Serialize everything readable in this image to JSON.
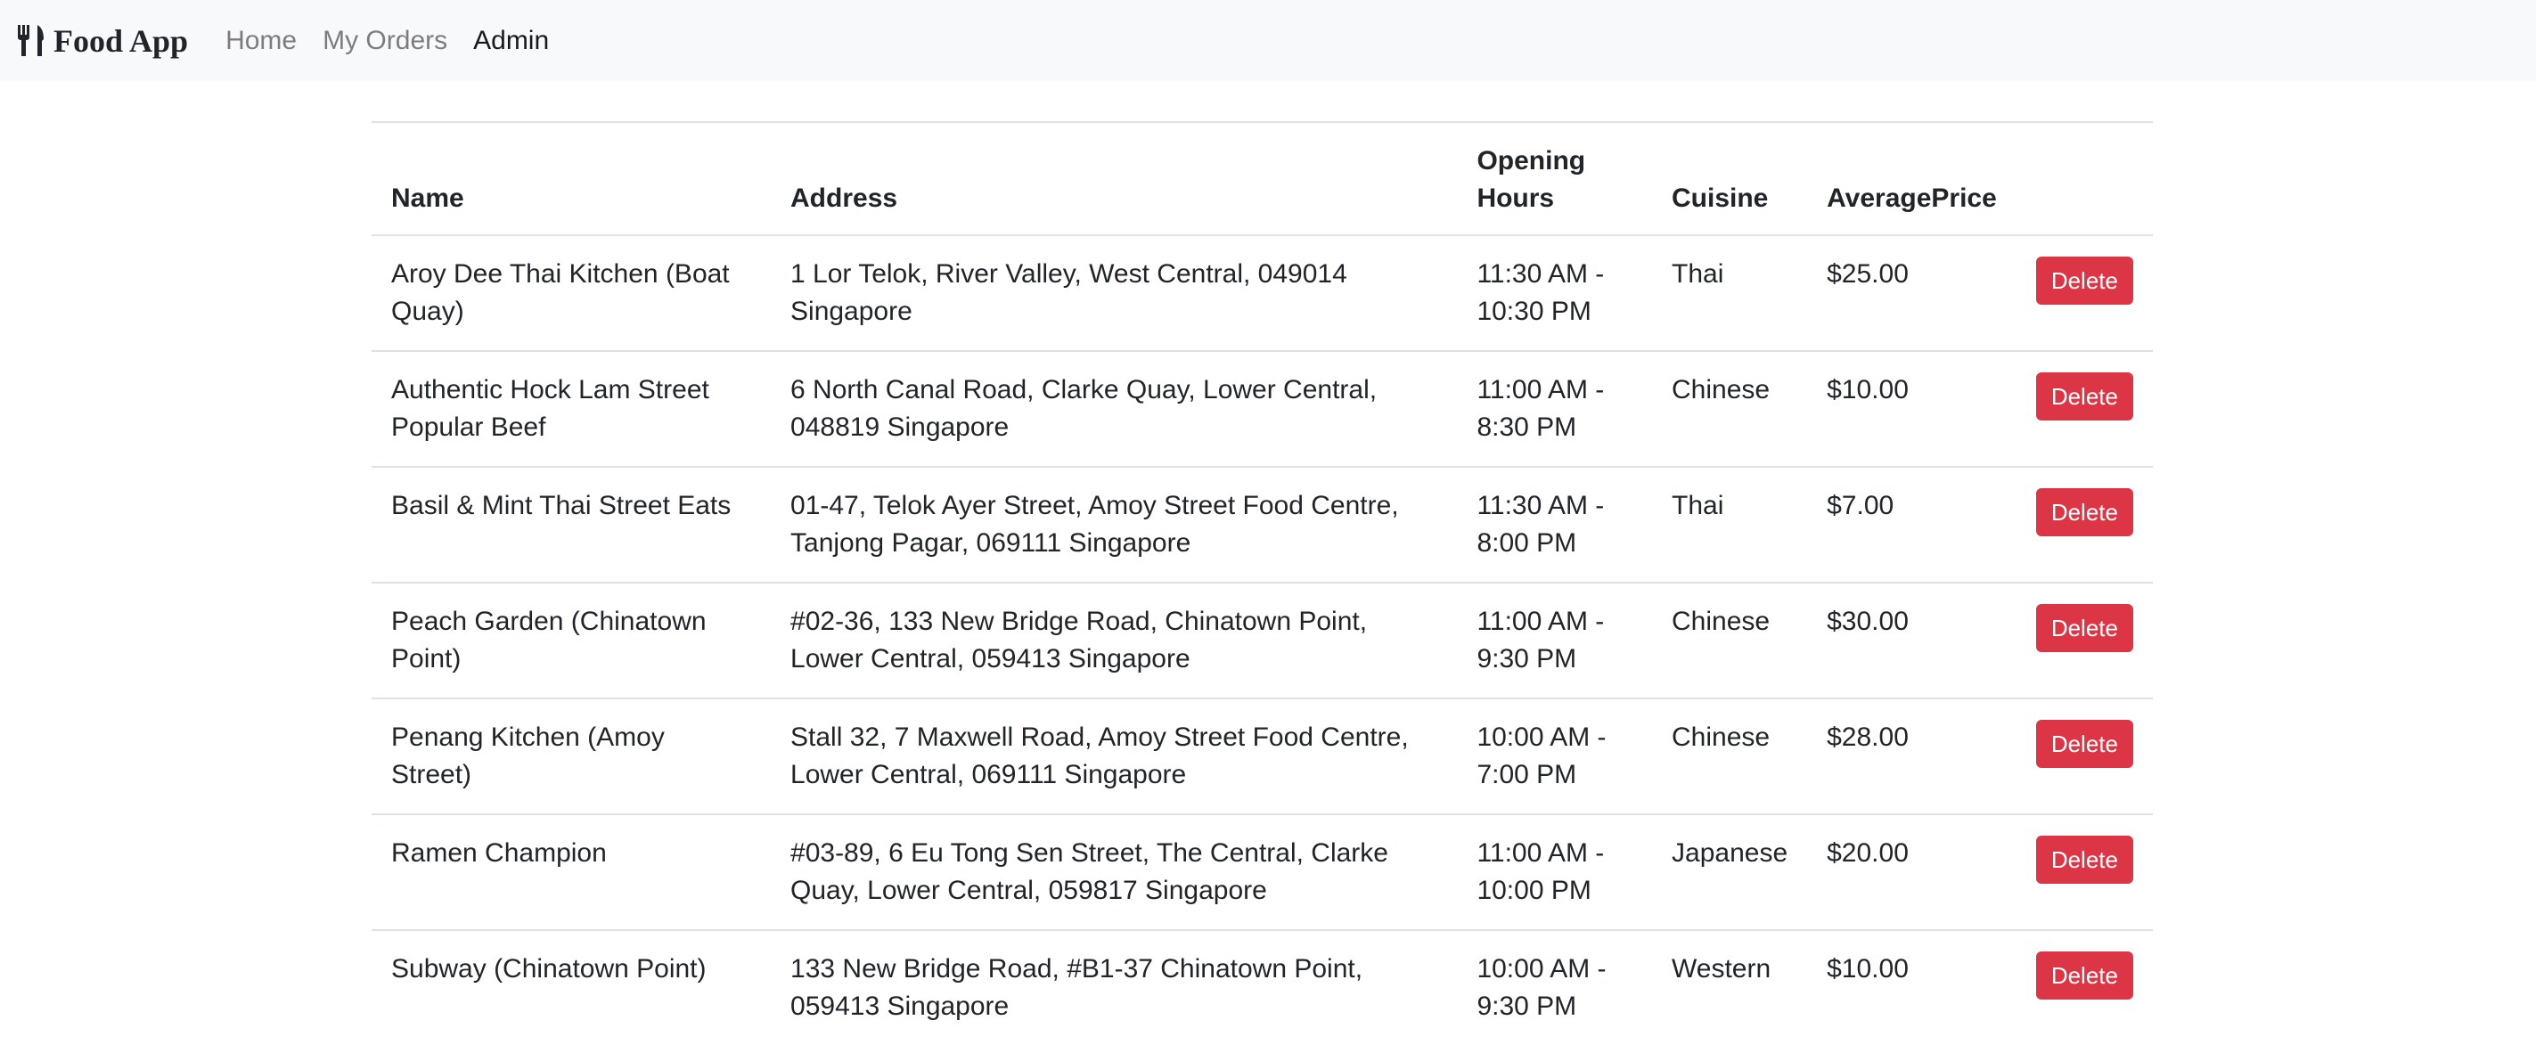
{
  "navbar": {
    "brand": "Food App",
    "brand_icon": "utensils-icon",
    "links": [
      "Home",
      "My Orders",
      "Admin"
    ],
    "active": "Admin"
  },
  "table": {
    "headers": [
      "Name",
      "Address",
      "Opening Hours",
      "Cuisine",
      "AveragePrice",
      ""
    ],
    "rows": [
      {
        "name": "Aroy Dee Thai Kitchen (Boat Quay)",
        "address": "1 Lor Telok, River Valley, West Central, 049014 Singapore",
        "hours": "11:30 AM - 10:30 PM",
        "cuisine": "Thai",
        "price": "$25.00",
        "action": "Delete"
      },
      {
        "name": "Authentic Hock Lam Street Popular Beef",
        "address": "6 North Canal Road, Clarke Quay, Lower Central, 048819 Singapore",
        "hours": "11:00 AM - 8:30 PM",
        "cuisine": "Chinese",
        "price": "$10.00",
        "action": "Delete"
      },
      {
        "name": "Basil & Mint Thai Street Eats",
        "address": "01-47, Telok Ayer Street, Amoy Street Food Centre, Tanjong Pagar, 069111 Singapore",
        "hours": "11:30 AM - 8:00 PM",
        "cuisine": "Thai",
        "price": "$7.00",
        "action": "Delete"
      },
      {
        "name": "Peach Garden (Chinatown Point)",
        "address": "#02-36, 133 New Bridge Road, Chinatown Point, Lower Central, 059413 Singapore",
        "hours": "11:00 AM - 9:30 PM",
        "cuisine": "Chinese",
        "price": "$30.00",
        "action": "Delete"
      },
      {
        "name": "Penang Kitchen (Amoy Street)",
        "address": "Stall 32, 7 Maxwell Road, Amoy Street Food Centre, Lower Central, 069111 Singapore",
        "hours": "10:00 AM - 7:00 PM",
        "cuisine": "Chinese",
        "price": "$28.00",
        "action": "Delete"
      },
      {
        "name": "Ramen Champion",
        "address": "#03-89, 6 Eu Tong Sen Street, The Central, Clarke Quay, Lower Central, 059817 Singapore",
        "hours": "11:00 AM - 10:00 PM",
        "cuisine": "Japanese",
        "price": "$20.00",
        "action": "Delete"
      },
      {
        "name": "Subway (Chinatown Point)",
        "address": "133 New Bridge Road, #B1-37 Chinatown Point, 059413 Singapore",
        "hours": "10:00 AM - 9:30 PM",
        "cuisine": "Western",
        "price": "$10.00",
        "action": "Delete"
      }
    ]
  },
  "colors": {
    "navbar_bg": "#f8f9fa",
    "danger": "#dc3545",
    "border": "#dee2e6",
    "text": "#212529"
  }
}
